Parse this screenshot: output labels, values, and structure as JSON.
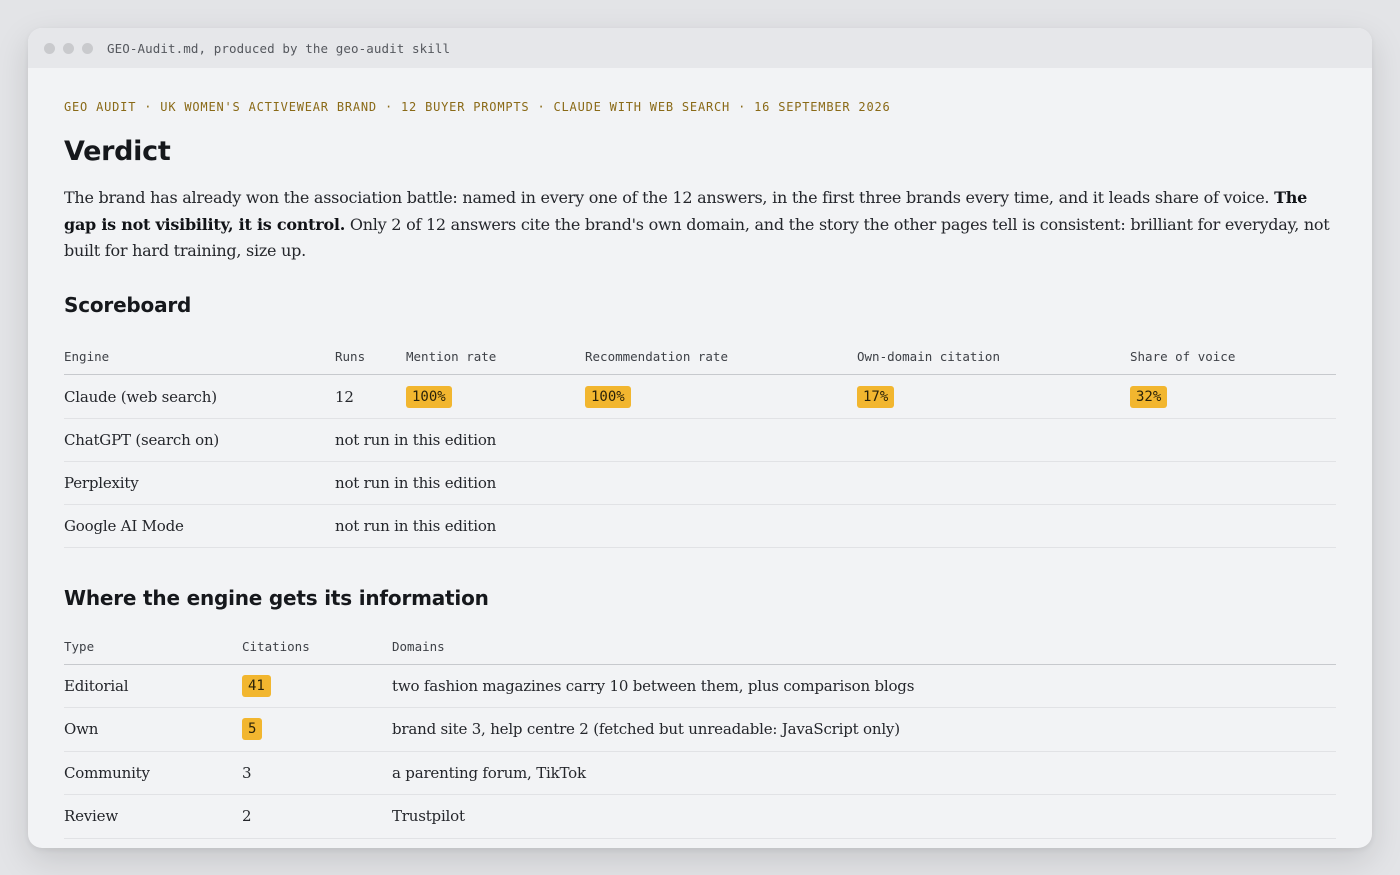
{
  "window": {
    "title": "GEO-Audit.md, produced by the geo-audit skill"
  },
  "kicker": "GEO AUDIT · UK WOMEN'S ACTIVEWEAR BRAND · 12 BUYER PROMPTS · CLAUDE WITH WEB SEARCH · 16 SEPTEMBER 2026",
  "verdict": {
    "heading": "Verdict",
    "text_before": "The brand has already won the association battle: named in every one of the 12 answers, in the first three brands every time, and it leads share of voice. ",
    "text_bold": "The gap is not visibility, it is control.",
    "text_after": " Only 2 of 12 answers cite the brand's own domain, and the story the other pages tell is consistent: brilliant for everyday, not built for hard training, size up."
  },
  "scoreboard": {
    "heading": "Scoreboard",
    "columns": [
      "Engine",
      "Runs",
      "Mention rate",
      "Recommendation rate",
      "Own-domain citation",
      "Share of voice"
    ],
    "claude": {
      "engine": "Claude (web search)",
      "runs": "12",
      "mention_rate": "100%",
      "recommendation_rate": "100%",
      "own_domain_citation": "17%",
      "share_of_voice": "32%"
    },
    "not_run": [
      {
        "engine": "ChatGPT (search on)",
        "status": "not run in this edition"
      },
      {
        "engine": "Perplexity",
        "status": "not run in this edition"
      },
      {
        "engine": "Google AI Mode",
        "status": "not run in this edition"
      }
    ]
  },
  "sources": {
    "heading": "Where the engine gets its information",
    "columns": [
      "Type",
      "Citations",
      "Domains"
    ],
    "rows": [
      {
        "type": "Editorial",
        "citations": "41",
        "domains": "two fashion magazines carry 10 between them, plus comparison blogs",
        "highlight": true
      },
      {
        "type": "Own",
        "citations": "5",
        "domains": "brand site 3, help centre 2 (fetched but unreadable: JavaScript only)",
        "highlight": true
      },
      {
        "type": "Community",
        "citations": "3",
        "domains": "a parenting forum, TikTok",
        "highlight": false
      },
      {
        "type": "Review",
        "citations": "2",
        "domains": "Trustpilot",
        "highlight": false
      }
    ]
  },
  "colors": {
    "highlight": "#f2b62f",
    "kicker": "#8a6a17",
    "background": "#f2f3f5"
  }
}
